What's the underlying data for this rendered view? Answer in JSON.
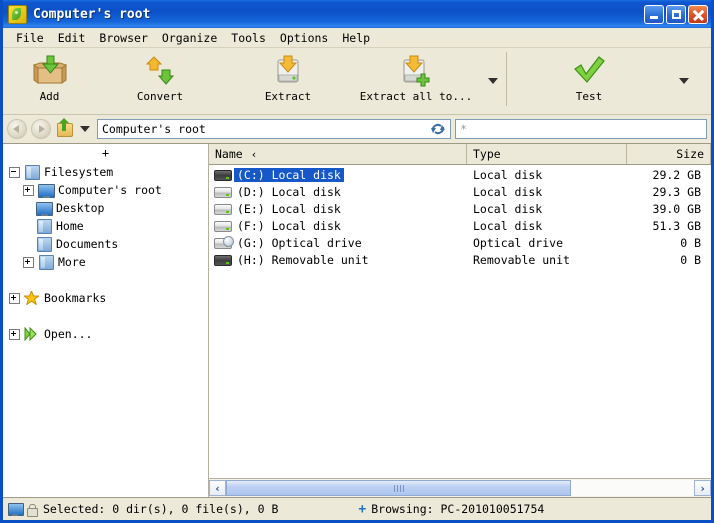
{
  "window": {
    "title": "Computer's root",
    "app_icon": "peazip-icon",
    "buttons": {
      "minimize": "minimize-button",
      "maximize": "maximize-button",
      "close": "close-button"
    }
  },
  "menubar": {
    "items": [
      "File",
      "Edit",
      "Browser",
      "Organize",
      "Tools",
      "Options",
      "Help"
    ]
  },
  "toolbar": {
    "items": [
      {
        "label": "Add",
        "icon": "add-box-icon",
        "dropdown": false
      },
      {
        "label": "Convert",
        "icon": "convert-arrows-icon",
        "dropdown": false
      },
      {
        "label": "Extract",
        "icon": "extract-drive-icon",
        "dropdown": false
      },
      {
        "label": "Extract all to...",
        "icon": "extract-all-drive-plus-icon",
        "dropdown": true
      },
      {
        "label": "Test",
        "icon": "green-check-icon",
        "dropdown": true
      }
    ]
  },
  "addressbar": {
    "back_icon": "back-arrow-icon",
    "forward_icon": "forward-arrow-icon",
    "up_icon": "up-folder-icon",
    "dropdown_icon": "chevron-down-icon",
    "path_value": "Computer's root",
    "refresh_icon": "refresh-icon",
    "filter_placeholder": "*",
    "filter_value": "*"
  },
  "sidebar": {
    "add_label": "+",
    "nodes": [
      {
        "label": "Filesystem",
        "icon": "folder-icon",
        "expander": "minus",
        "indent": 0
      },
      {
        "label": "Computer's root",
        "icon": "monitor-icon",
        "expander": "plus",
        "indent": 1
      },
      {
        "label": "Desktop",
        "icon": "monitor-icon",
        "expander": "none",
        "indent": 1
      },
      {
        "label": "Home",
        "icon": "folder-icon",
        "expander": "none",
        "indent": 1
      },
      {
        "label": "Documents",
        "icon": "folder-icon",
        "expander": "none",
        "indent": 1
      },
      {
        "label": "More",
        "icon": "folder-icon",
        "expander": "plus",
        "indent": 1
      },
      {
        "label": "Bookmarks",
        "icon": "star-icon",
        "expander": "plus",
        "indent": 0,
        "spacer_before": true
      },
      {
        "label": "Open...",
        "icon": "open-arrow-icon",
        "expander": "plus",
        "indent": 0,
        "spacer_before": true
      }
    ]
  },
  "filelist": {
    "columns": [
      {
        "key": "name",
        "label": "Name",
        "sort_mark": "‹"
      },
      {
        "key": "type",
        "label": "Type",
        "sort_mark": ""
      },
      {
        "key": "size",
        "label": "Size",
        "sort_mark": ""
      }
    ],
    "rows": [
      {
        "name": "(C:) Local disk",
        "type": "Local disk",
        "size": "29.2 GB",
        "icon": "local-disk-icon",
        "selected": true
      },
      {
        "name": "(D:) Local disk",
        "type": "Local disk",
        "size": "29.3 GB",
        "icon": "local-disk-icon",
        "selected": false
      },
      {
        "name": "(E:) Local disk",
        "type": "Local disk",
        "size": "39.0 GB",
        "icon": "local-disk-icon",
        "selected": false
      },
      {
        "name": "(F:) Local disk",
        "type": "Local disk",
        "size": "51.3 GB",
        "icon": "local-disk-icon",
        "selected": false
      },
      {
        "name": "(G:) Optical drive",
        "type": "Optical drive",
        "size": "0 B",
        "icon": "optical-drive-icon",
        "selected": false
      },
      {
        "name": "(H:) Removable unit",
        "type": "Removable unit",
        "size": "0 B",
        "icon": "removable-unit-icon",
        "selected": false
      }
    ]
  },
  "scrollbar": {
    "left_arrow": "‹",
    "right_arrow": "›"
  },
  "statusbar": {
    "computer_icon": "monitor-icon",
    "lock_icon": "lock-icon",
    "selection_text": "Selected: 0 dir(s), 0 file(s), 0 B",
    "browsing_marker": "+",
    "browsing_text": "Browsing: PC-201010051754"
  },
  "colors": {
    "titlebar_blue": "#0d50c8",
    "selection_blue": "#1658c8",
    "chrome_beige": "#ece9d8",
    "accent_green": "#49a521"
  }
}
